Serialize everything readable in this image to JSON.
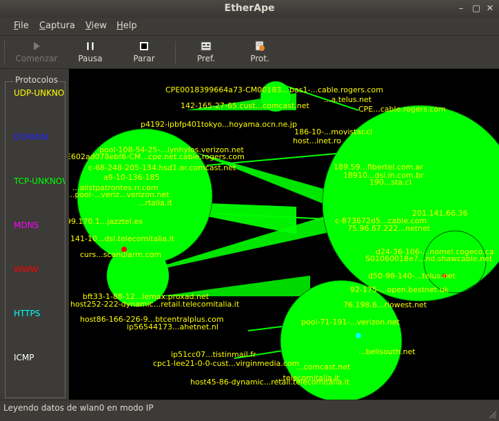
{
  "window": {
    "title": "EtherApe"
  },
  "menu": {
    "items": [
      {
        "label": "File",
        "u": "F",
        "rest": "ile"
      },
      {
        "label": "Captura",
        "u": "C",
        "rest": "aptura"
      },
      {
        "label": "View",
        "u": "V",
        "rest": "iew"
      },
      {
        "label": "Help",
        "u": "H",
        "rest": "elp"
      }
    ]
  },
  "toolbar": {
    "start_label": "Comenzar",
    "pause_label": "Pausa",
    "stop_label": "Parar",
    "prefs_label": "Pref.",
    "protocols_label": "Prot."
  },
  "sidebar": {
    "title": "Protocolos",
    "protocols": [
      {
        "label": "UDP-UNKNOWN",
        "color": "#ffff00"
      },
      {
        "label": "DOMAIN",
        "color": "#2020ff"
      },
      {
        "label": "TCP-UNKNOWN",
        "color": "#00ff00"
      },
      {
        "label": "MDNS",
        "color": "#ff00ff"
      },
      {
        "label": "WWW",
        "color": "#ff0000"
      },
      {
        "label": "HTTPS",
        "color": "#00ffff"
      },
      {
        "label": "ICMP",
        "color": "#ffffff"
      }
    ]
  },
  "graph": {
    "node_color": "#00ff00",
    "label_color": "#ffff00",
    "labels": [
      "CPE0018399664a73-CM00183...",
      "bas1-...cable.rogers.com",
      "...a.telus.net",
      "142-165-27-65.cust...comcast.net",
      "CPE...cable.rogers.com",
      "p4192-ipbfp401tokyo...hoyama.ocn.ne.jp",
      "186-10-...movistar.cl",
      "host...inet.ro",
      "pool-108-54-25-...lynhylos.verizon.net",
      "E602ad078ebf6-CM...cpe.net.cable.rogers.com",
      "c-68-248-205-134.hsd1.or.comcast.net",
      "189.59...fibertel.com.ar",
      "18910...dsl.in.com.br",
      "190...sta.cl",
      "a9-10-136-185",
      "...alistpatrontes.rr.com",
      "...pool-...veriz...verizon.net",
      "...rtalia.it",
      "c-873672d5...cable.com",
      "75.96.67.222...netnet",
      "201.141.66.36",
      "99.170.1...jazztel.es",
      "141-10...dsl.telecomitalia.it",
      "d24-36-106-...nomel.cogeco.ca",
      "S01060018e7...nd.shawcable.net",
      "curs...scandiarm.com",
      "d50-98-140-...telus.net",
      "92-175-...open.bestnet.uk",
      "bft33-1-88-12...lemax.proxad.net",
      "host252-222-dynamic...retail.telecomitalia.it",
      "76.198.6...riowest.net",
      "host86-166-226-9...btcentralplus.com",
      "ip56544173...ahetnet.nl",
      "pool-71-191-...verizon.net",
      "cpc1-lee21-0-0-cust...virginmedia.com",
      "ip51cc07...tistinmail.fr",
      "host45-86-dynamic...retail.telecomitalia.it",
      "...bellsouth.net",
      "...comcast.net",
      "...telecomitalia.it"
    ]
  },
  "status": {
    "text": "Leyendo datos de wlan0 en modo IP"
  }
}
